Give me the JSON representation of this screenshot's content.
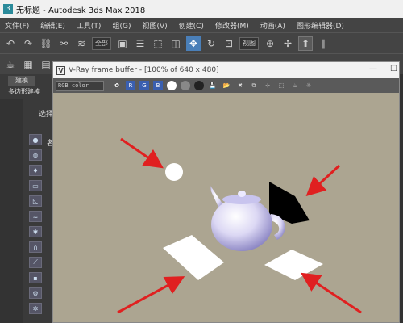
{
  "window": {
    "title": "无标题 - Autodesk 3ds Max 2018"
  },
  "menu": [
    "文件(F)",
    "编辑(E)",
    "工具(T)",
    "组(G)",
    "视图(V)",
    "创建(C)",
    "修改器(M)",
    "动画(A)",
    "图形编辑器(D)"
  ],
  "toolbar": {
    "selection_filter": "全部",
    "view_dropdown": "视图"
  },
  "ribbon": {
    "tab": "建模",
    "subtab": "多边形建模"
  },
  "command_panel": {
    "select_label": "选择",
    "name_label": "名"
  },
  "vray": {
    "title": "V-Ray frame buffer - [100% of 640 x 480]",
    "channel": "RGB color",
    "r": "R",
    "g": "G",
    "b": "B"
  },
  "colors": {
    "viewport_bg": "#aca591",
    "arrow": "#e02020",
    "vray_accent": "#3a5fb0"
  }
}
